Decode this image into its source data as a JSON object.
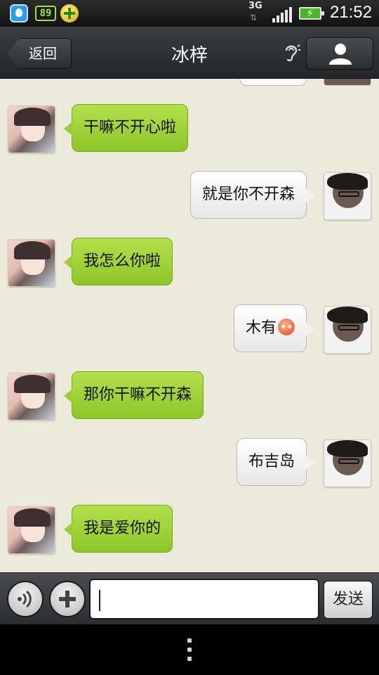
{
  "status_bar": {
    "battery_app_label": "89",
    "network": "3G",
    "network_arrows": "⇅",
    "time": "21:52",
    "icons": [
      "qq-icon",
      "battery-app-icon",
      "security-360-icon",
      "3g-icon",
      "signal-icon",
      "battery-icon"
    ]
  },
  "header": {
    "back_label": "返回",
    "title": "冰梓",
    "icons": [
      "ear-icon",
      "person-icon"
    ]
  },
  "messages": [
    {
      "sender": "her",
      "text": "干嘛不开心啦"
    },
    {
      "sender": "me",
      "text": "就是你不开森"
    },
    {
      "sender": "her",
      "text": "我怎么你啦"
    },
    {
      "sender": "me",
      "text": "木有",
      "emoji": "blush-emoji"
    },
    {
      "sender": "her",
      "text": "那你干嘛不开森"
    },
    {
      "sender": "me",
      "text": "布吉岛"
    },
    {
      "sender": "her",
      "text": "我是爱你的"
    }
  ],
  "input_bar": {
    "input_value": "",
    "input_placeholder": "",
    "send_label": "发送",
    "icons": [
      "voice-icon",
      "plus-icon"
    ]
  },
  "colors": {
    "her_bubble": "#9ccf36",
    "my_bubble": "#f2f2f2",
    "chat_background": "#ecebdb",
    "bar_dark": "#2b2d2f"
  }
}
